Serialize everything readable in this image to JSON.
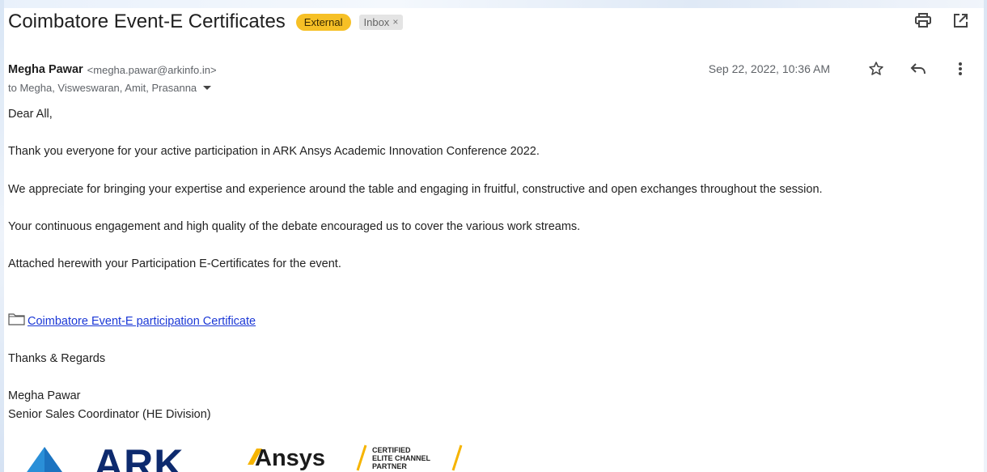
{
  "email": {
    "subject": "Coimbatore Event-E Certificates",
    "labels": {
      "external": "External",
      "inbox": "Inbox",
      "inbox_remove": "×"
    },
    "sender": {
      "name": "Megha Pawar",
      "email": "<megha.pawar@arkinfo.in>"
    },
    "recipients": "to Megha, Visweswaran, Amit, Prasanna",
    "date": "Sep 22, 2022, 10:36 AM",
    "body": {
      "greeting": "Dear All,",
      "p1": "Thank you everyone for your active participation in ARK Ansys Academic Innovation Conference 2022.",
      "p2": "We appreciate for bringing your expertise and experience around the table and engaging in fruitful, constructive and open exchanges throughout the session.",
      "p3": "Your continuous engagement and high quality of the debate encouraged us to cover the various work streams.",
      "p4": "Attached herewith your Participation E-Certificates for the event.",
      "attachment_link": "Coimbatore Event-E participation Certificate",
      "closing": "Thanks & Regards",
      "signature_name": "Megha Pawar",
      "signature_title": "Senior Sales Coordinator (HE Division)"
    },
    "signature_logos": {
      "ark": "ARK",
      "ansys": "Ansys",
      "partner_line1": "CERTIFIED",
      "partner_line2": "ELITE CHANNEL",
      "partner_line3": "PARTNER"
    }
  },
  "icons": {
    "print": "print-icon",
    "open_new_window": "open-in-new-icon",
    "star": "star-icon",
    "reply": "reply-icon",
    "more": "more-vert-icon",
    "recipients_expand": "caret-down-icon",
    "attachment": "folder-icon"
  },
  "colors": {
    "external_label": "#f6c026",
    "inbox_label": "#e4e4e4",
    "link": "#1a37d6",
    "ark_blue": "#0d2a6e",
    "ark_triangle": "#2a8fd8",
    "ansys_accent": "#f6b400"
  }
}
